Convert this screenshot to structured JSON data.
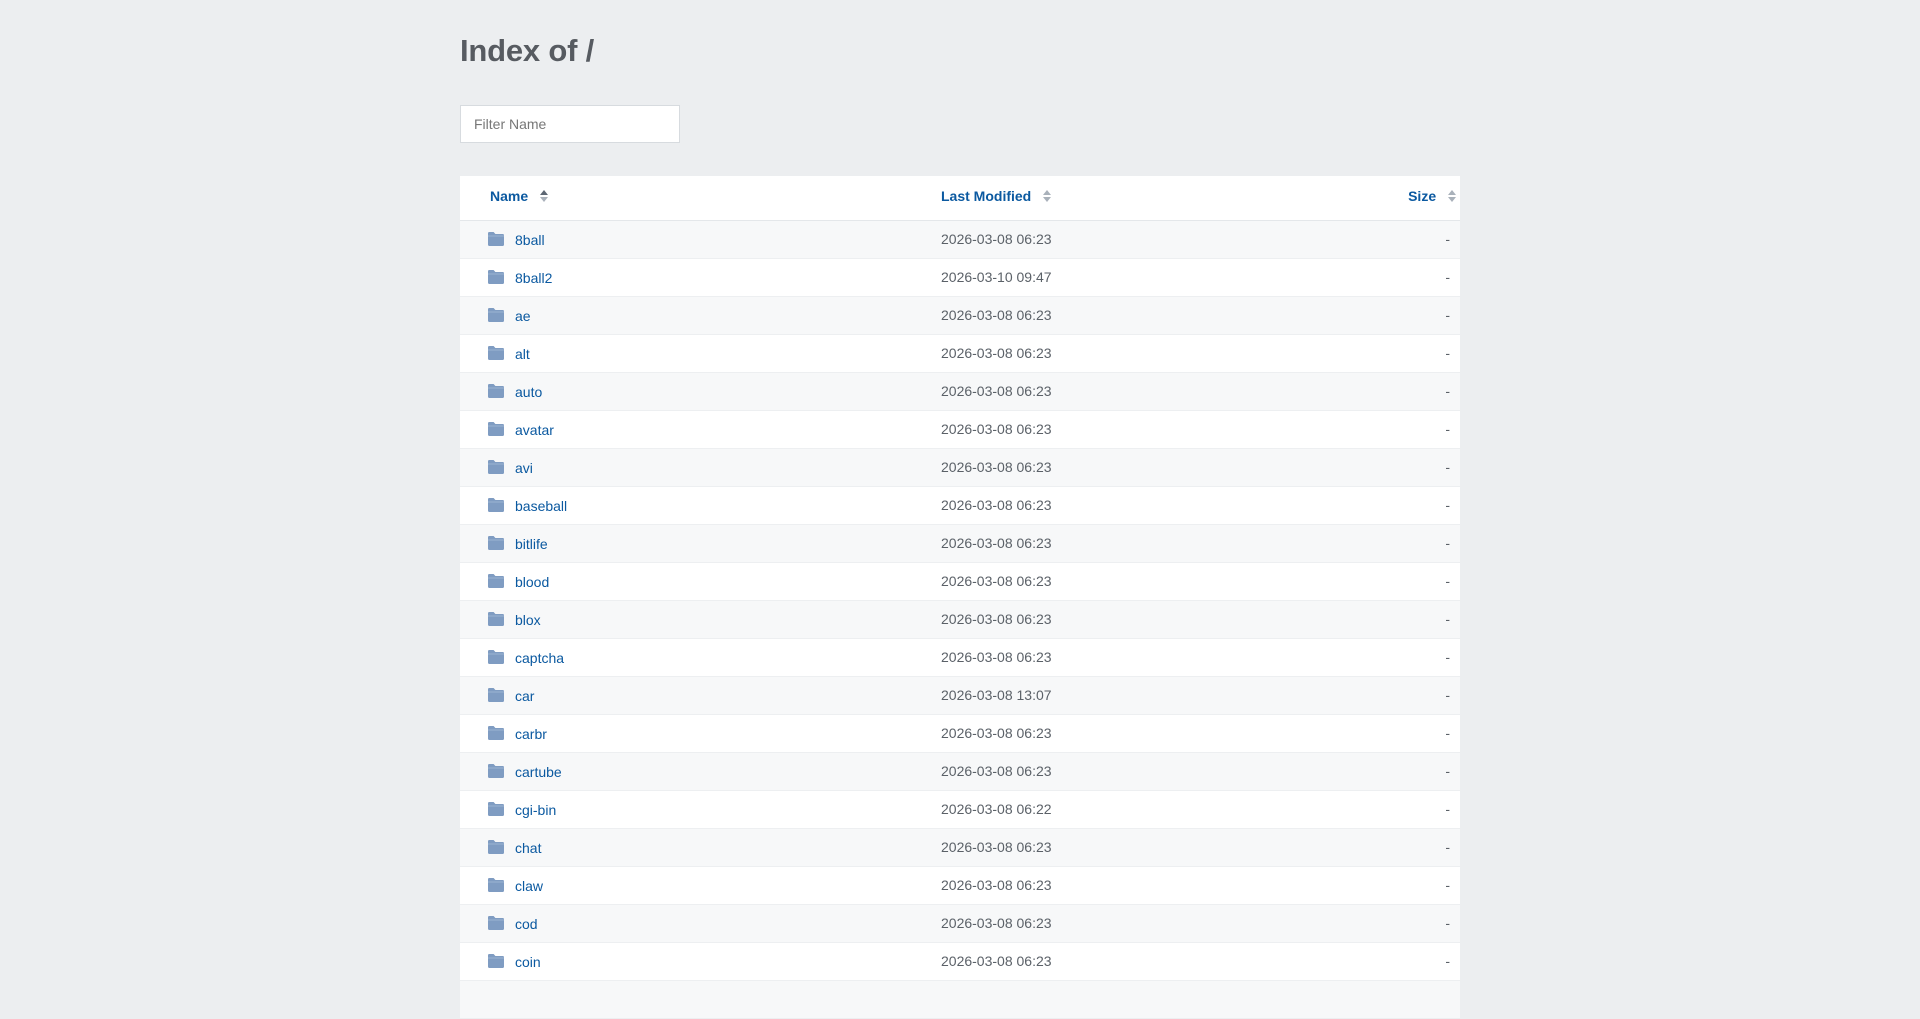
{
  "page": {
    "title": "Index of /",
    "filter_placeholder": "Filter Name"
  },
  "table": {
    "headers": {
      "name": "Name",
      "last_modified": "Last Modified",
      "size": "Size"
    },
    "rows": [
      {
        "name": "8ball",
        "modified": "2026-03-08 06:23",
        "size": "-"
      },
      {
        "name": "8ball2",
        "modified": "2026-03-10 09:47",
        "size": "-"
      },
      {
        "name": "ae",
        "modified": "2026-03-08 06:23",
        "size": "-"
      },
      {
        "name": "alt",
        "modified": "2026-03-08 06:23",
        "size": "-"
      },
      {
        "name": "auto",
        "modified": "2026-03-08 06:23",
        "size": "-"
      },
      {
        "name": "avatar",
        "modified": "2026-03-08 06:23",
        "size": "-"
      },
      {
        "name": "avi",
        "modified": "2026-03-08 06:23",
        "size": "-"
      },
      {
        "name": "baseball",
        "modified": "2026-03-08 06:23",
        "size": "-"
      },
      {
        "name": "bitlife",
        "modified": "2026-03-08 06:23",
        "size": "-"
      },
      {
        "name": "blood",
        "modified": "2026-03-08 06:23",
        "size": "-"
      },
      {
        "name": "blox",
        "modified": "2026-03-08 06:23",
        "size": "-"
      },
      {
        "name": "captcha",
        "modified": "2026-03-08 06:23",
        "size": "-"
      },
      {
        "name": "car",
        "modified": "2026-03-08 13:07",
        "size": "-"
      },
      {
        "name": "carbr",
        "modified": "2026-03-08 06:23",
        "size": "-"
      },
      {
        "name": "cartube",
        "modified": "2026-03-08 06:23",
        "size": "-"
      },
      {
        "name": "cgi-bin",
        "modified": "2026-03-08 06:22",
        "size": "-"
      },
      {
        "name": "chat",
        "modified": "2026-03-08 06:23",
        "size": "-"
      },
      {
        "name": "claw",
        "modified": "2026-03-08 06:23",
        "size": "-"
      },
      {
        "name": "cod",
        "modified": "2026-03-08 06:23",
        "size": "-"
      },
      {
        "name": "coin",
        "modified": "2026-03-08 06:23",
        "size": "-"
      },
      {
        "name": "",
        "modified": "",
        "size": ""
      }
    ]
  },
  "colors": {
    "background": "#eceef0",
    "link": "#0b59a0",
    "folder_icon": "#7f9cc2",
    "text_muted": "#5b6168"
  },
  "icons": {
    "row_icon": "folder-icon",
    "sort_icon": "sort-arrows-icon"
  }
}
